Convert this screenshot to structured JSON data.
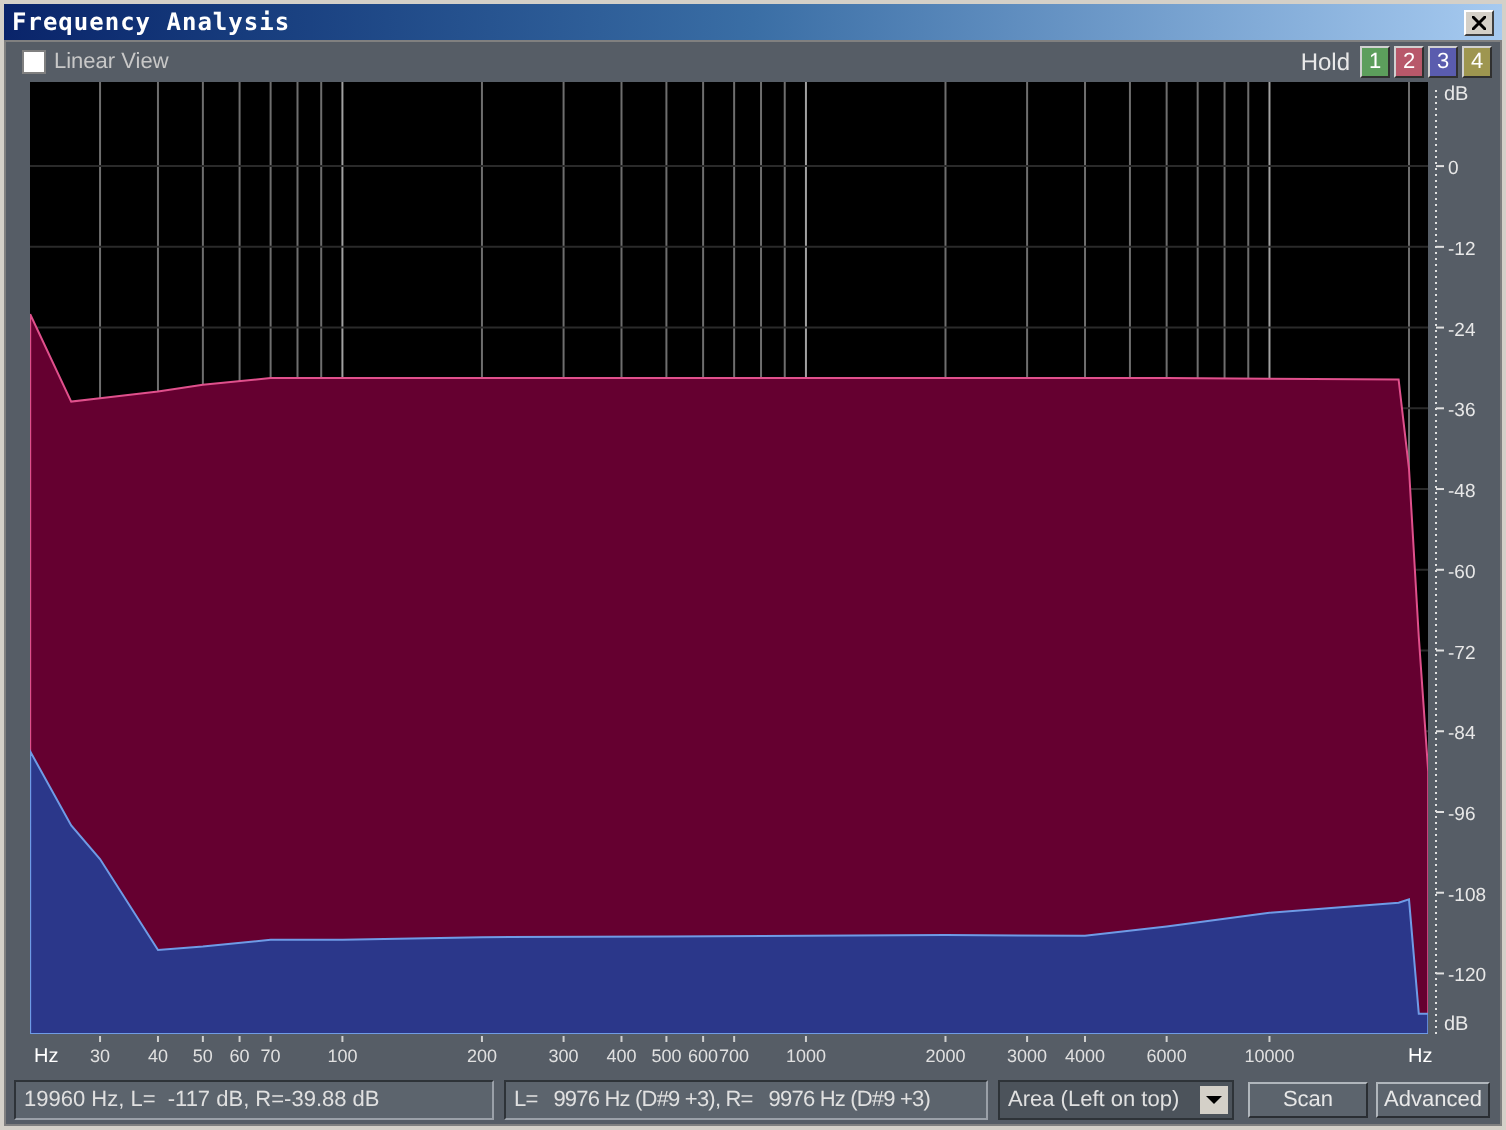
{
  "window": {
    "title": "Frequency Analysis"
  },
  "toolbar": {
    "linear_view": {
      "label": "Linear View",
      "checked": false
    },
    "hold": {
      "label": "Hold",
      "buttons": [
        {
          "label": "1",
          "color": "#5c9e5c"
        },
        {
          "label": "2",
          "color": "#b8586a"
        },
        {
          "label": "3",
          "color": "#5a5cae"
        },
        {
          "label": "4",
          "color": "#9e9650"
        }
      ]
    }
  },
  "chart": {
    "x_axis": {
      "unit_left": "Hz",
      "unit_right": "Hz",
      "labels": [
        "30",
        "40",
        "50",
        "60",
        "70",
        "100",
        "200",
        "300",
        "400",
        "500",
        "600",
        "700",
        "1000",
        "2000",
        "3000",
        "4000",
        "6000",
        "10000"
      ]
    },
    "y_axis": {
      "unit_top": "dB",
      "unit_bottom": "dB",
      "labels": [
        "0",
        "-12",
        "-24",
        "-36",
        "-48",
        "-60",
        "-72",
        "-84",
        "-96",
        "-108",
        "-120"
      ]
    }
  },
  "status": {
    "cursor_readout": "19960 Hz, L=  -117 dB, R=-39.88 dB",
    "peak_readout": "L=   9976 Hz (D#9 +3), R=   9976 Hz (D#9 +3)",
    "display_mode": "Area (Left on top)",
    "buttons": [
      "Scan",
      "Advanced"
    ]
  }
}
